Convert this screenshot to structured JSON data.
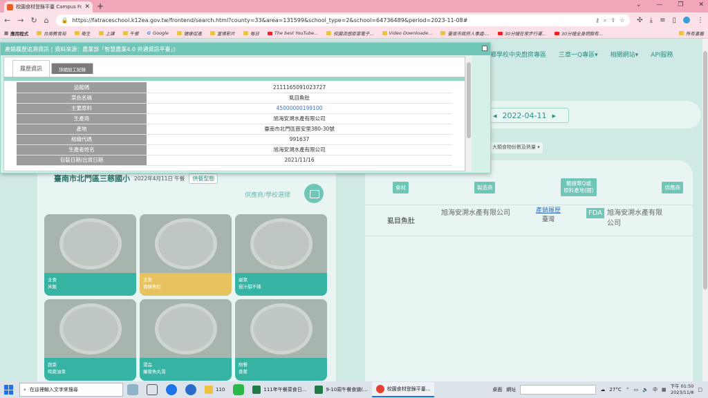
{
  "browser": {
    "tab_title": "校園食材登錄平臺 Campus Foo",
    "url": "https://fatraceschool.k12ea.gov.tw/frontend/search.html?county=33&area=131599&school_type=2&school=64736489&period=2023-11-08#",
    "bookmarks": [
      "應用程式",
      "台南教育局",
      "衛生",
      "上課",
      "午餐",
      "Google",
      "健康促進",
      "宣導影片",
      "每日",
      "The best YouTube...",
      "校園流感疫苗電子...",
      "Video Downloade...",
      "臺南市政府人事處-...",
      "30分鐘在家步行運...",
      "30分鐘全身燃脂有..."
    ],
    "bookmarks_other": "所有書籤"
  },
  "site": {
    "nav": [
      "偏鄉學校中央廚房專區",
      "三章一Q專區▾",
      "相關網站▾",
      "API服務"
    ],
    "date": "2022-04-11",
    "select_label": "大類食物份數及熱量"
  },
  "popup": {
    "title": "產銷履歷追溯資訊 ( 資料來源：農業部「智慧農業4.0 共通資訊平臺」)",
    "tabs": [
      "履歷資訊",
      "詳細加工紀錄"
    ],
    "rows": [
      {
        "k": "追蹤碼",
        "v": "2111165091023727"
      },
      {
        "k": "菜色名稱",
        "v": "虱目魚肚"
      },
      {
        "k": "主要原料",
        "v": "45000000199100"
      },
      {
        "k": "生產商",
        "v": "旭海安溯水產有限公司"
      },
      {
        "k": "產地",
        "v": "臺南市北門區慈安里380-30號"
      },
      {
        "k": "組織代碼",
        "v": "991637"
      },
      {
        "k": "生產者姓名",
        "v": "旭海安溯水產有限公司"
      },
      {
        "k": "包裝日期/出貨日期",
        "v": "2021/11/16"
      }
    ]
  },
  "left": {
    "school": "臺南市北門區三慈國小",
    "date_meal": "2022年4月11日 午餐",
    "type_btn": "供餐型態",
    "supplier_select": "供應商/學校選擇",
    "dishes": [
      {
        "cat": "主食",
        "name": "米飯"
      },
      {
        "cat": "主菜",
        "name": "香酥魚肚"
      },
      {
        "cat": "副菜",
        "name": "茄汁甜不辣"
      },
      {
        "cat": "蔬菜",
        "name": "時蔬油菜"
      },
      {
        "cat": "湯品",
        "name": "蘿蔔魚丸湯"
      },
      {
        "cat": "附餐",
        "name": "香蕉"
      }
    ]
  },
  "right": {
    "headers": [
      "食材",
      "製造商",
      "驗證章Q或\n原料產地(國)",
      "供應商"
    ],
    "row": {
      "ingredient": "虱目魚肚",
      "maker": "旭海安溯水產有限公司",
      "cert_link": "產銷履歷",
      "origin": "臺灣",
      "fda": "FDA",
      "supplier": "旭海安溯水產有限公司"
    }
  },
  "taskbar": {
    "search": "在這裡輸入文字來搜尋",
    "apps": [
      "110",
      "111年午餐菜食日...",
      "9-10周午餐食譜(...",
      "校園食材登錄平臺..."
    ],
    "desktop": "桌面",
    "url_label": "網址",
    "weather": "27°C",
    "ime": "中",
    "time": "下午 01:50",
    "date": "2023/11/8"
  }
}
